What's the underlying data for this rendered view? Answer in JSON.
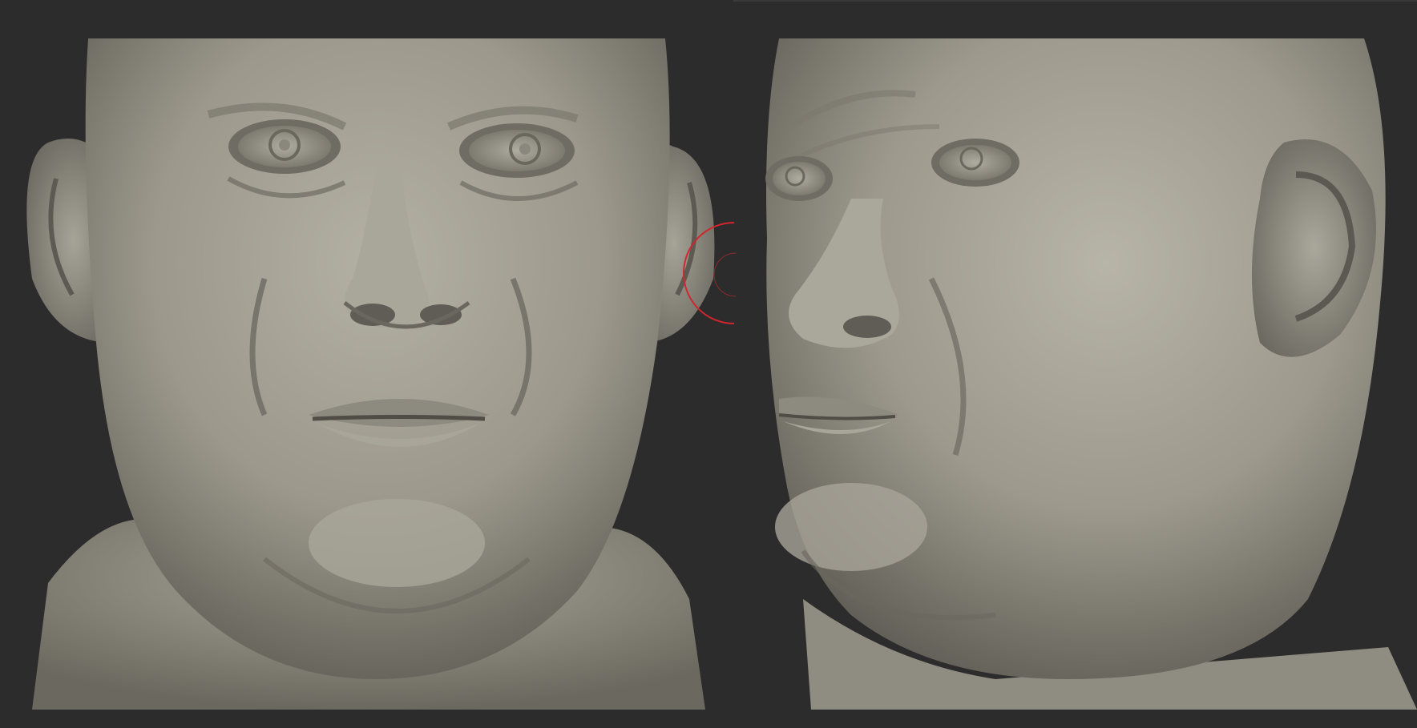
{
  "app": {
    "background_color": "#2c2c2c",
    "clay_color": "#9c998c",
    "brush_cursor_color": "#d0262e"
  },
  "viewports": [
    {
      "view": "front",
      "icon": "sculpt-mesh"
    },
    {
      "view": "three-quarter-right",
      "icon": "sculpt-mesh"
    }
  ],
  "brush_cursor": {
    "icon": "brush-circle-icon"
  }
}
